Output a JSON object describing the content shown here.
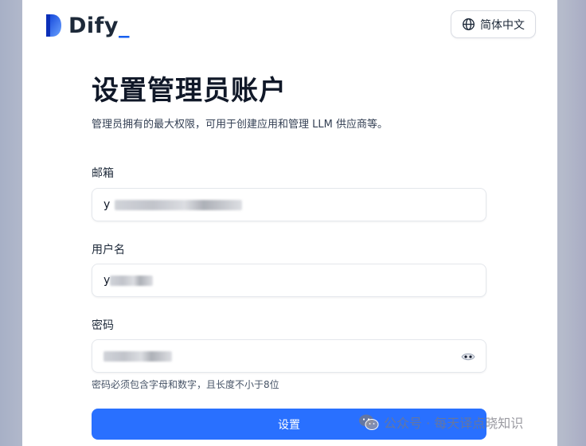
{
  "header": {
    "brand": "Dify",
    "brand_accent": "_",
    "language_label": "简体中文"
  },
  "page": {
    "title": "设置管理员账户",
    "subtitle": "管理员拥有的最大权限，可用于创建应用和管理 LLM 供应商等。"
  },
  "form": {
    "email": {
      "label": "邮箱",
      "value": "y",
      "value_redacted": true
    },
    "username": {
      "label": "用户名",
      "value": "y",
      "value_redacted": true
    },
    "password": {
      "label": "密码",
      "value_redacted": true,
      "toggle_icon": "eye-icon"
    },
    "password_hint": "密码必须包含字母和数字，且长度不小于8位",
    "submit_label": "设置"
  },
  "watermark": {
    "text": "公众号 · 每天译点晓知识",
    "icon": "wechat-icon"
  },
  "colors": {
    "primary": "#2970ff",
    "brand_blue": "#155eef",
    "text": "#101828",
    "border": "#e4e7ec",
    "backdrop": "#b5bbcb"
  }
}
